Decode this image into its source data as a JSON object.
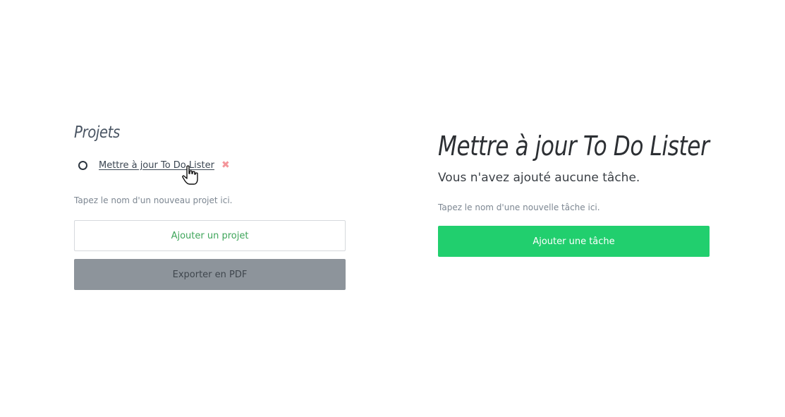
{
  "projects": {
    "title": "Projets",
    "items": [
      {
        "label": "Mettre à jour To Do Lister",
        "delete_symbol": "✖"
      }
    ],
    "input_placeholder": "Tapez le nom d'un nouveau projet ici.",
    "add_button": "Ajouter un projet",
    "export_button": "Exporter en PDF"
  },
  "task_panel": {
    "title": "Mettre à jour To Do Lister",
    "empty_message": "Vous n'avez ajouté aucune tâche.",
    "input_placeholder": "Tapez le nom d'une nouvelle tâche ici.",
    "add_button": "Ajouter une tâche"
  },
  "colors": {
    "accent_green": "#21cf6e",
    "delete_red": "#f4959a",
    "export_gray": "#8d949b"
  },
  "icons": {
    "project_status": "circle-icon",
    "delete": "delete-icon",
    "cursor": "hand-pointer-icon"
  }
}
